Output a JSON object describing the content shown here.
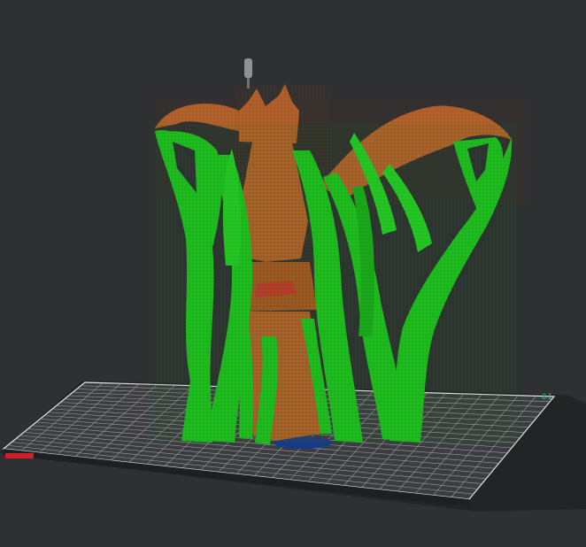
{
  "viewport": {
    "background": "#2f3032",
    "plate_label": "01",
    "colors": {
      "plate": "#3a3b3e",
      "plate_edge": "#232426",
      "grid": "#9a9ca0",
      "grid_border": "#e4e4e4",
      "support": "#1fbe1f",
      "support_dark": "#128a12",
      "model": "#b3622c",
      "model_dark": "#7f3f15",
      "nozzle": "#8e9196",
      "origin_marker": "#d11f2a",
      "brim": "#173a8a",
      "plate_label": "#2ec27e"
    },
    "icons": {
      "nozzle": "nozzle-icon",
      "origin": "origin-marker-icon"
    }
  }
}
